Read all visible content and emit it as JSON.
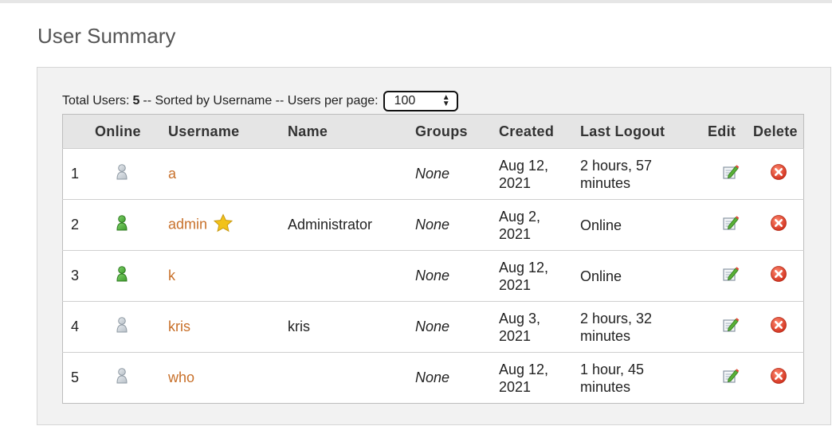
{
  "page": {
    "title": "User Summary"
  },
  "summary": {
    "total_label": "Total Users:",
    "total_count": "5",
    "sort_text": "-- Sorted by Username -- Users per page:",
    "per_page_value": "100"
  },
  "table": {
    "headers": {
      "online": "Online",
      "username": "Username",
      "name": "Name",
      "groups": "Groups",
      "created": "Created",
      "last_logout": "Last Logout",
      "edit": "Edit",
      "delete": "Delete"
    },
    "rows": [
      {
        "num": "1",
        "online": false,
        "username": "a",
        "admin": false,
        "name": "",
        "groups": "None",
        "created_1": "Aug 12,",
        "created_2": "2021",
        "logout_1": "2 hours, 57",
        "logout_2": "minutes"
      },
      {
        "num": "2",
        "online": true,
        "username": "admin",
        "admin": true,
        "name": "Administrator",
        "groups": "None",
        "created_1": "Aug 2,",
        "created_2": "2021",
        "logout_1": "Online",
        "logout_2": ""
      },
      {
        "num": "3",
        "online": true,
        "username": "k",
        "admin": false,
        "name": "",
        "groups": "None",
        "created_1": "Aug 12,",
        "created_2": "2021",
        "logout_1": "Online",
        "logout_2": ""
      },
      {
        "num": "4",
        "online": false,
        "username": "kris",
        "admin": false,
        "name": "kris",
        "groups": "None",
        "created_1": "Aug 3,",
        "created_2": "2021",
        "logout_1": "2 hours, 32",
        "logout_2": "minutes"
      },
      {
        "num": "5",
        "online": false,
        "username": "who",
        "admin": false,
        "name": "",
        "groups": "None",
        "created_1": "Aug 12,",
        "created_2": "2021",
        "logout_1": "1 hour, 45",
        "logout_2": "minutes"
      }
    ]
  },
  "colors": {
    "link": "#c8702a",
    "online_user": "#3e9c2c",
    "offline_user": "#b9c1c8",
    "delete_red": "#e0422b",
    "admin_star": "#f2c21a"
  },
  "icons": {
    "online": "user-online-icon",
    "offline": "user-offline-icon",
    "admin": "admin-star-icon",
    "edit": "edit-icon",
    "delete": "delete-icon"
  }
}
